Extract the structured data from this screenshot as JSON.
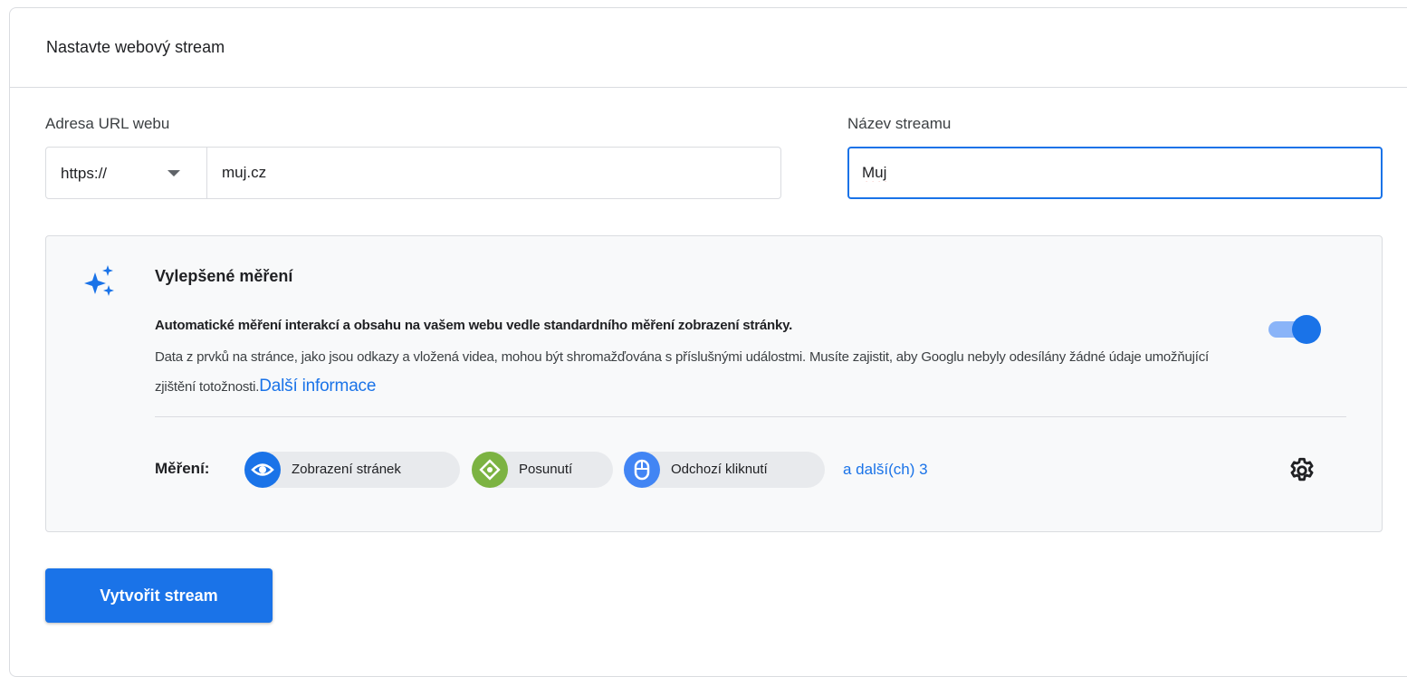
{
  "card": {
    "title": "Nastavte webový stream"
  },
  "url_field": {
    "label": "Adresa URL webu",
    "protocol": "https://",
    "value": "muj.cz"
  },
  "name_field": {
    "label": "Název streamu",
    "value": "Muj"
  },
  "enhanced_measurement": {
    "title": "Vylepšené měření",
    "lead": "Automatické měření interakcí a obsahu na vašem webu vedle standardního měření zobrazení stránky.",
    "description": "Data z prvků na stránce, jako jsou odkazy a vložená videa, mohou být shromažďována s příslušnými událostmi. Musíte zajistit, aby Googlu nebyly odesílány žádné údaje umožňující zjištění totožnosti.",
    "link": "Další informace",
    "toggle_on": true,
    "measurements_label": "Měření:",
    "chips": [
      {
        "label": "Zobrazení stránek",
        "icon": "eye-icon",
        "color": "#1a73e8"
      },
      {
        "label": "Posunutí",
        "icon": "scroll-icon",
        "color": "#7cb342"
      },
      {
        "label": "Odchozí kliknutí",
        "icon": "mouse-icon",
        "color": "#4285f4"
      }
    ],
    "more_link": "a další(ch) 3"
  },
  "actions": {
    "create_label": "Vytvořit stream"
  },
  "colors": {
    "accent": "#1a73e8",
    "toggle_track": "#8ab4f8",
    "panel_bg": "#f8f9fa",
    "border": "#dadce0"
  }
}
